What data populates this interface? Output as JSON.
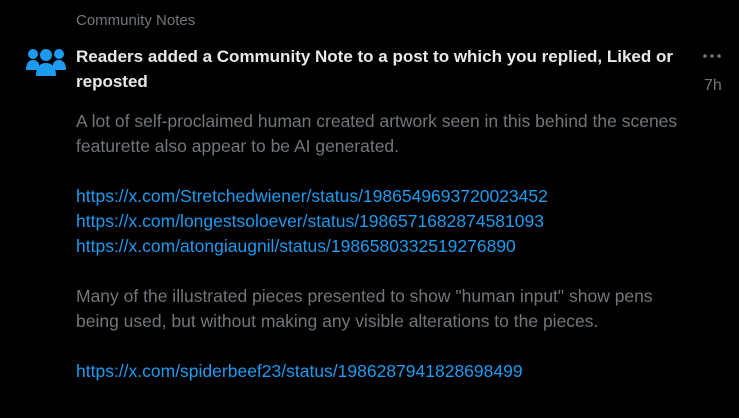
{
  "header": {
    "section_label": "Community Notes"
  },
  "notification": {
    "icon": "community-people-icon",
    "title": "Readers added a Community Note to a post to which you replied, Liked or reposted",
    "more_icon": "more-dots-icon",
    "timestamp": "7h"
  },
  "note": {
    "paragraph_1": "A lot of self-proclaimed human created artwork seen in this behind the scenes featurette also appear to be AI generated.",
    "links_1": [
      "https://x.com/Stretchedwiener/status/1986549693720023452",
      "https://x.com/longestsoloever/status/1986571682874581093",
      "https://x.com/atongiaugnil/status/1986580332519276890"
    ],
    "paragraph_2": "Many of the illustrated pieces presented to show \"human input\" show pens being used, but without making any visible alterations to the pieces.",
    "links_2": [
      "https://x.com/spiderbeef23/status/1986287941828698499"
    ]
  },
  "colors": {
    "background": "#000000",
    "title_text": "#e7e9ea",
    "muted_text": "#71767b",
    "link": "#1d9bf0",
    "icon": "#1d9bf0"
  }
}
